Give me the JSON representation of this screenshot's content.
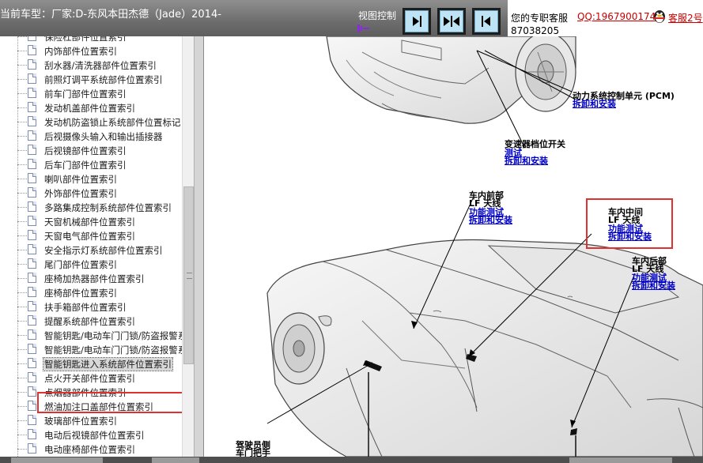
{
  "header": {
    "car_title": "当前车型：厂家:D-东风本田杰德（Jade）2014-",
    "view_control_label": "视图控制",
    "buttons": [
      {
        "name": "collapse-left-button",
        "icon": "arrow-right-bar-icon"
      },
      {
        "name": "split-view-button",
        "icon": "split-arrows-icon"
      },
      {
        "name": "expand-left-button",
        "icon": "arrow-left-bar-icon"
      }
    ]
  },
  "support": {
    "label": "您的专职客服",
    "qq": "QQ:1967900174",
    "kefu": "客服2号",
    "phone": "87038205"
  },
  "sidebar": {
    "items": [
      "保险杠部件位置索引",
      "内饰部件位置索引",
      "刮水器/清洗器部件位置索引",
      "前照灯调平系统部件位置索引",
      "前车门部件位置索引",
      "发动机盖部件位置索引",
      "发动机防盗锁止系统部件位置标记",
      "后视摄像头输入和输出插接器",
      "后视镜部件位置索引",
      "后车门部件位置索引",
      "喇叭部件位置索引",
      "外饰部件位置索引",
      "多路集成控制系统部件位置索引",
      "天窗机械部件位置索引",
      "天窗电气部件位置索引",
      "安全指示灯系统部件位置索引",
      "尾门部件位置索引",
      "座椅加热器部件位置索引",
      "座椅部件位置索引",
      "扶手箱部件位置索引",
      "提醒系统部件位置索引",
      "智能钥匙/电动车门门锁/防盗报警系",
      "智能钥匙/电动车门门锁/防盗报警系",
      "智能钥匙进入系统部件位置索引",
      "点火开关部件位置索引",
      "点烟器部件位置索引",
      "燃油加注口盖部件位置索引",
      "玻璃部件位置索引",
      "电动后视镜部件位置索引",
      "电动座椅部件位置索引"
    ],
    "selected_index": 23
  },
  "diagram": {
    "pcm": {
      "title": "动力系统控制单元 (PCM)",
      "link1": "拆卸和安装"
    },
    "shift_switch": {
      "title": "变速器档位开关",
      "link1": "测试",
      "link2": "拆卸和安装"
    },
    "front_antenna": {
      "title": "车内前部",
      "subtitle": "LF 天线",
      "link1": "功能测试",
      "link2": "拆卸和安装"
    },
    "middle_antenna": {
      "title": "车内中间",
      "subtitle": "LF 天线",
      "link1": "功能测试",
      "link2": "拆卸和安装"
    },
    "rear_antenna": {
      "title": "车内后部",
      "subtitle": "LF 天线",
      "link1": "功能测试",
      "link2": "拆卸和安装"
    },
    "driver_side": {
      "title": "驾驶员侧",
      "subtitle": "车门把手"
    }
  }
}
